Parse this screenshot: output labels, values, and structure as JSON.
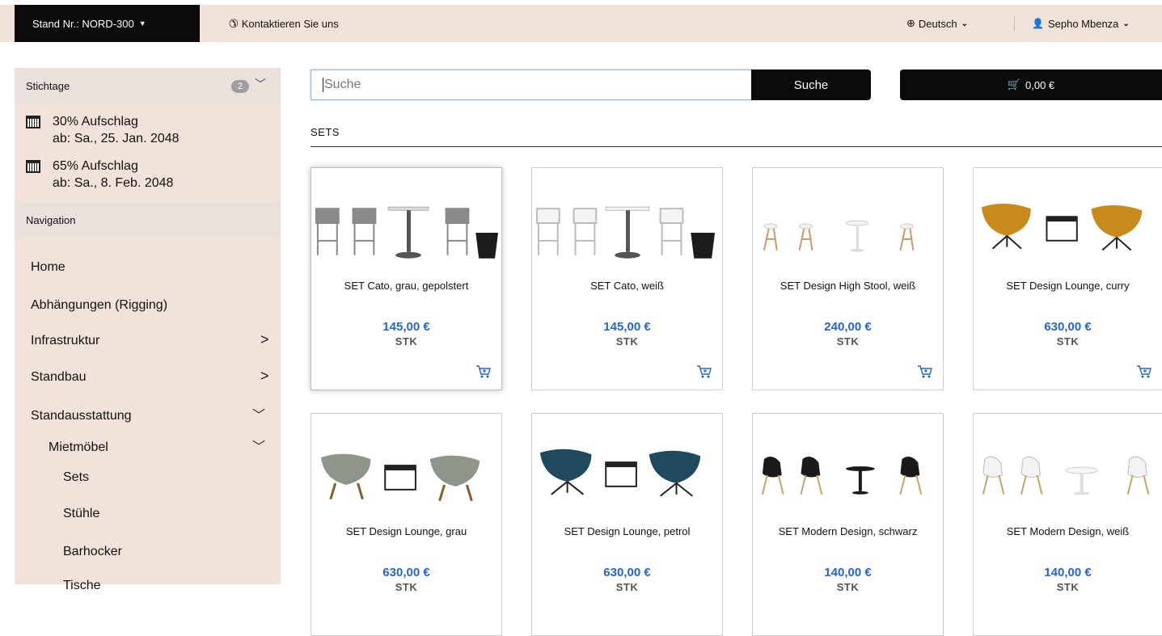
{
  "topbar": {
    "stand": "Stand Nr.: NORD-300",
    "contact": "Kontaktieren Sie uns",
    "language": "Deutsch",
    "user": "Sepho Mbenza"
  },
  "sidebar": {
    "deadlines": {
      "title": "Stichtage",
      "count": "2",
      "items": [
        {
          "line1": "30% Aufschlag",
          "line2": "ab: Sa., 25. Jan. 2048"
        },
        {
          "line1": "65% Aufschlag",
          "line2": "ab: Sa., 8. Feb. 2048"
        }
      ]
    },
    "navigation": {
      "title": "Navigation",
      "items": [
        "Home",
        "Abhängungen (Rigging)",
        "Infrastruktur",
        "Standbau",
        "Standausstattung",
        "Mietmöbel",
        "Sets",
        "Stühle",
        "Barhocker",
        "Tische"
      ]
    }
  },
  "search": {
    "placeholder": "Suche",
    "button": "Suche"
  },
  "cart": {
    "total": "0,00 €"
  },
  "section_title": "SETS",
  "products": [
    {
      "name": "SET Cato, grau, gepolstert",
      "price": "145,00 €",
      "unit": "STK"
    },
    {
      "name": "SET Cato, weiß",
      "price": "145,00 €",
      "unit": "STK"
    },
    {
      "name": "SET Design High Stool, weiß",
      "price": "240,00 €",
      "unit": "STK"
    },
    {
      "name": "SET Design Lounge, curry",
      "price": "630,00 €",
      "unit": "STK"
    },
    {
      "name": "SET Design Lounge, grau",
      "price": "630,00 €",
      "unit": "STK"
    },
    {
      "name": "SET Design Lounge, petrol",
      "price": "630,00 €",
      "unit": "STK"
    },
    {
      "name": "SET Modern Design, schwarz",
      "price": "140,00 €",
      "unit": "STK"
    },
    {
      "name": "SET Modern Design, weiß",
      "price": "140,00 €",
      "unit": "STK"
    }
  ],
  "colors": {
    "accent_price": "#2563d9",
    "sidebar_bg": "#f1e3da",
    "dark": "#0b0b0b"
  }
}
